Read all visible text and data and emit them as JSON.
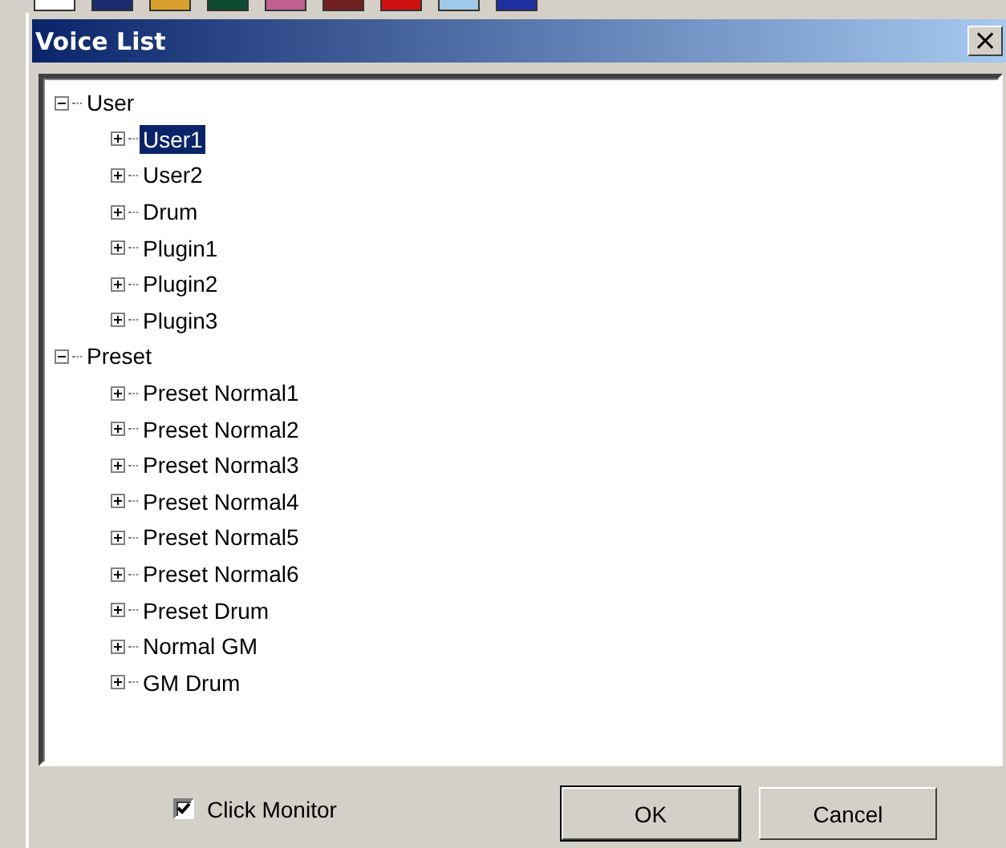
{
  "window": {
    "title": "Voice List",
    "close": "×"
  },
  "tree": [
    {
      "label": "User",
      "expanded": true,
      "selected": false,
      "children": [
        {
          "label": "User1",
          "expanded": false,
          "selected": true
        },
        {
          "label": "User2",
          "expanded": false,
          "selected": false
        },
        {
          "label": "Drum",
          "expanded": false,
          "selected": false
        },
        {
          "label": "Plugin1",
          "expanded": false,
          "selected": false
        },
        {
          "label": "Plugin2",
          "expanded": false,
          "selected": false
        },
        {
          "label": "Plugin3",
          "expanded": false,
          "selected": false
        }
      ]
    },
    {
      "label": "Preset",
      "expanded": true,
      "selected": false,
      "children": [
        {
          "label": "Preset Normal1",
          "expanded": false,
          "selected": false
        },
        {
          "label": "Preset Normal2",
          "expanded": false,
          "selected": false
        },
        {
          "label": "Preset Normal3",
          "expanded": false,
          "selected": false
        },
        {
          "label": "Preset Normal4",
          "expanded": false,
          "selected": false
        },
        {
          "label": "Preset Normal5",
          "expanded": false,
          "selected": false
        },
        {
          "label": "Preset Normal6",
          "expanded": false,
          "selected": false
        },
        {
          "label": "Preset Drum",
          "expanded": false,
          "selected": false
        },
        {
          "label": "Normal GM",
          "expanded": false,
          "selected": false
        },
        {
          "label": "GM Drum",
          "expanded": false,
          "selected": false
        }
      ]
    }
  ],
  "click_monitor": {
    "label": "Click Monitor",
    "checked": true
  },
  "buttons": [
    "OK",
    "Cancel"
  ]
}
